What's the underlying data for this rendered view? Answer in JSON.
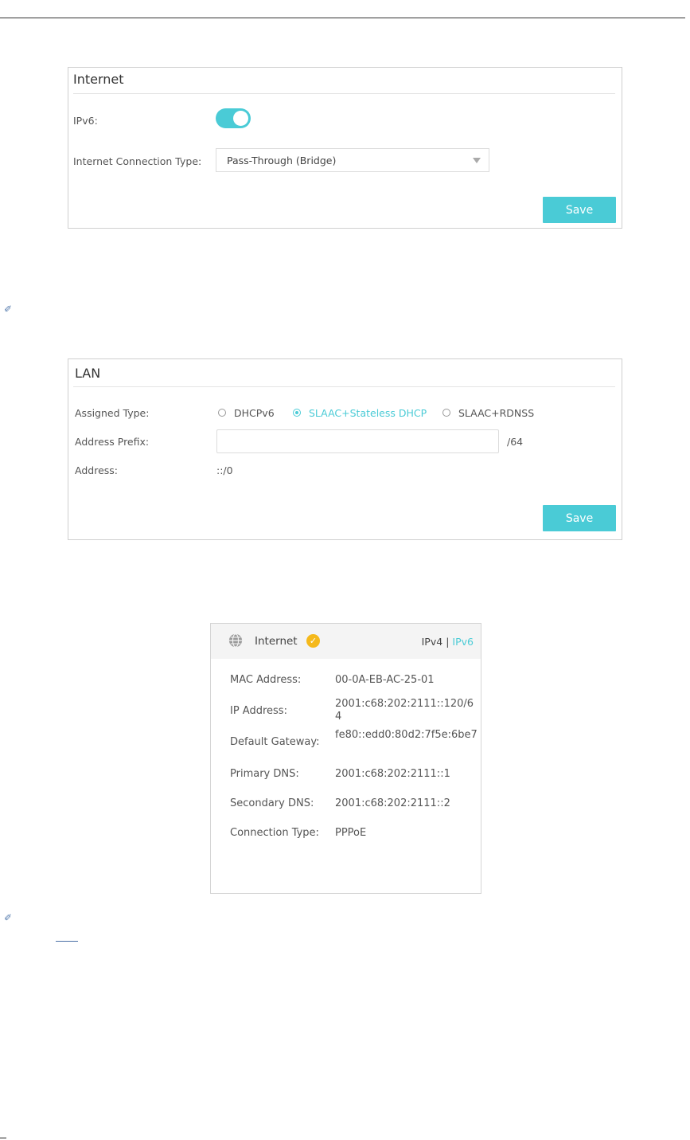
{
  "internet_panel": {
    "title": "Internet",
    "ipv6_label": "IPv6:",
    "ipv6_enabled": true,
    "connection_type_label": "Internet Connection Type:",
    "connection_type_value": "Pass-Through (Bridge)",
    "save_label": "Save"
  },
  "lan_panel": {
    "title": "LAN",
    "assigned_type_label": "Assigned Type:",
    "assigned_options": [
      "DHCPv6",
      "SLAAC+Stateless DHCP",
      "SLAAC+RDNSS"
    ],
    "assigned_selected": "SLAAC+Stateless DHCP",
    "address_prefix_label": "Address Prefix:",
    "address_prefix_value": "",
    "prefix_suffix": "/64",
    "address_label": "Address:",
    "address_value": "::/0",
    "save_label": "Save"
  },
  "status_card": {
    "title": "Internet",
    "tab_ipv4": "IPv4",
    "tab_separator": "|",
    "tab_ipv6": "IPv6",
    "active_tab": "IPv6",
    "rows": [
      {
        "label": "MAC Address:",
        "value": "00-0A-EB-AC-25-01"
      },
      {
        "label": "IP Address:",
        "value": "2001:c68:202:2111::120/64"
      },
      {
        "label": "Default Gateway:",
        "value": "fe80::edd0:80d2:7f5e:6be7"
      },
      {
        "label": "Primary DNS:",
        "value": "2001:c68:202:2111::1"
      },
      {
        "label": "Secondary DNS:",
        "value": "2001:c68:202:2111::2"
      },
      {
        "label": "Connection Type:",
        "value": "PPPoE"
      }
    ]
  },
  "colors": {
    "accent": "#4acbd6",
    "status_ok": "#f5b91b"
  },
  "icons": [
    "note-clip-icon",
    "globe-icon",
    "check-icon",
    "dropdown-arrow-icon"
  ]
}
